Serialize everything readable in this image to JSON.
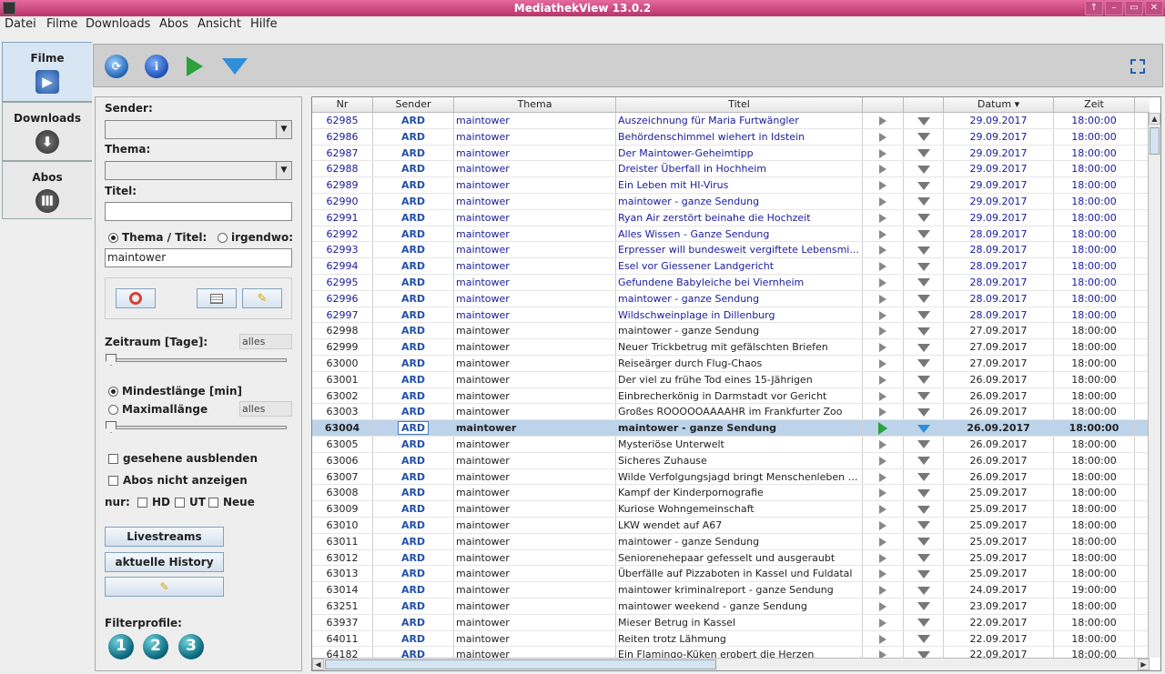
{
  "window": {
    "title": "MediathekView 13.0.2",
    "controls": [
      "↑",
      "–",
      "▭",
      "✕"
    ]
  },
  "menu": [
    {
      "label": "Datei"
    },
    {
      "label": "Filme"
    },
    {
      "label": "Downloads"
    },
    {
      "label": "Abos"
    },
    {
      "label": "Ansicht"
    },
    {
      "label": "Hilfe"
    }
  ],
  "sidetabs": [
    {
      "label": "Filme",
      "icon": "play-film-icon",
      "active": true
    },
    {
      "label": "Downloads",
      "icon": "download-arrow-icon",
      "active": false
    },
    {
      "label": "Abos",
      "icon": "abos-icon",
      "active": false
    }
  ],
  "toolbar": {
    "icons": [
      "update-filmlist-icon",
      "info-icon",
      "play-icon",
      "download-icon"
    ],
    "fullscreen_icon": "fullscreen-icon"
  },
  "filter": {
    "sender_label": "Sender:",
    "sender_value": "",
    "thema_label": "Thema:",
    "thema_value": "",
    "titel_label": "Titel:",
    "titel_value": "",
    "radio_thema_titel": "Thema / Titel:",
    "radio_irgendwo": "irgendwo:",
    "search_value": "maintower",
    "zeitraum_label": "Zeitraum [Tage]:",
    "zeitraum_value": "alles",
    "zeitraum_level": 0,
    "mindestlaenge_label": "Mindestlänge [min]",
    "maximallaenge_label": "Maximallänge",
    "maximallaenge_value": "alles",
    "laenge_level": 0,
    "gesehene_ausblenden": "gesehene ausblenden",
    "abos_nicht_anzeigen": "Abos nicht anzeigen",
    "nur_label": "nur:",
    "hd": "HD",
    "ut": "UT",
    "neue": "Neue",
    "livestreams": "Livestreams",
    "aktuelle_history": "aktuelle History",
    "filterprofile_label": "Filterprofile:",
    "profiles": [
      "1",
      "2",
      "3"
    ]
  },
  "table": {
    "columns": [
      "Nr",
      "Sender",
      "Thema",
      "Titel",
      "",
      "",
      "Datum ▾",
      "Zeit"
    ],
    "rows": [
      {
        "nr": "62985",
        "sender": "ARD",
        "thema": "maintower",
        "titel": "Auszeichnung für Maria Furtwängler",
        "datum": "29.09.2017",
        "zeit": "18:00:00",
        "new": true
      },
      {
        "nr": "62986",
        "sender": "ARD",
        "thema": "maintower",
        "titel": "Behördenschimmel wiehert in Idstein",
        "datum": "29.09.2017",
        "zeit": "18:00:00",
        "new": true
      },
      {
        "nr": "62987",
        "sender": "ARD",
        "thema": "maintower",
        "titel": "Der Maintower-Geheimtipp",
        "datum": "29.09.2017",
        "zeit": "18:00:00",
        "new": true
      },
      {
        "nr": "62988",
        "sender": "ARD",
        "thema": "maintower",
        "titel": "Dreister Überfall in Hochheim",
        "datum": "29.09.2017",
        "zeit": "18:00:00",
        "new": true
      },
      {
        "nr": "62989",
        "sender": "ARD",
        "thema": "maintower",
        "titel": "Ein Leben mit HI-Virus",
        "datum": "29.09.2017",
        "zeit": "18:00:00",
        "new": true
      },
      {
        "nr": "62990",
        "sender": "ARD",
        "thema": "maintower",
        "titel": "maintower - ganze Sendung",
        "datum": "29.09.2017",
        "zeit": "18:00:00",
        "new": true
      },
      {
        "nr": "62991",
        "sender": "ARD",
        "thema": "maintower",
        "titel": "Ryan Air zerstört beinahe die Hochzeit",
        "datum": "29.09.2017",
        "zeit": "18:00:00",
        "new": true
      },
      {
        "nr": "62992",
        "sender": "ARD",
        "thema": "maintower",
        "titel": "Alles Wissen - Ganze Sendung",
        "datum": "28.09.2017",
        "zeit": "18:00:00",
        "new": true
      },
      {
        "nr": "62993",
        "sender": "ARD",
        "thema": "maintower",
        "titel": "Erpresser will bundesweit vergiftete Lebensmi...",
        "datum": "28.09.2017",
        "zeit": "18:00:00",
        "new": true
      },
      {
        "nr": "62994",
        "sender": "ARD",
        "thema": "maintower",
        "titel": "Esel vor Giessener Landgericht",
        "datum": "28.09.2017",
        "zeit": "18:00:00",
        "new": true
      },
      {
        "nr": "62995",
        "sender": "ARD",
        "thema": "maintower",
        "titel": "Gefundene Babyleiche bei Viernheim",
        "datum": "28.09.2017",
        "zeit": "18:00:00",
        "new": true
      },
      {
        "nr": "62996",
        "sender": "ARD",
        "thema": "maintower",
        "titel": "maintower - ganze Sendung",
        "datum": "28.09.2017",
        "zeit": "18:00:00",
        "new": true
      },
      {
        "nr": "62997",
        "sender": "ARD",
        "thema": "maintower",
        "titel": "Wildschweinplage in Dillenburg",
        "datum": "28.09.2017",
        "zeit": "18:00:00",
        "new": true
      },
      {
        "nr": "62998",
        "sender": "ARD",
        "thema": "maintower",
        "titel": "maintower - ganze Sendung",
        "datum": "27.09.2017",
        "zeit": "18:00:00",
        "new": false
      },
      {
        "nr": "62999",
        "sender": "ARD",
        "thema": "maintower",
        "titel": "Neuer Trickbetrug mit gefälschten Briefen",
        "datum": "27.09.2017",
        "zeit": "18:00:00",
        "new": false
      },
      {
        "nr": "63000",
        "sender": "ARD",
        "thema": "maintower",
        "titel": "Reiseärger durch Flug-Chaos",
        "datum": "27.09.2017",
        "zeit": "18:00:00",
        "new": false
      },
      {
        "nr": "63001",
        "sender": "ARD",
        "thema": "maintower",
        "titel": "Der viel zu frühe Tod eines 15-Jährigen",
        "datum": "26.09.2017",
        "zeit": "18:00:00",
        "new": false
      },
      {
        "nr": "63002",
        "sender": "ARD",
        "thema": "maintower",
        "titel": "Einbrecherkönig in Darmstadt vor Gericht",
        "datum": "26.09.2017",
        "zeit": "18:00:00",
        "new": false
      },
      {
        "nr": "63003",
        "sender": "ARD",
        "thema": "maintower",
        "titel": "Großes ROOOOOAAAAHR im Frankfurter Zoo",
        "datum": "26.09.2017",
        "zeit": "18:00:00",
        "new": false
      },
      {
        "nr": "63004",
        "sender": "ARD",
        "thema": "maintower",
        "titel": "maintower - ganze Sendung",
        "datum": "26.09.2017",
        "zeit": "18:00:00",
        "new": false,
        "selected": true
      },
      {
        "nr": "63005",
        "sender": "ARD",
        "thema": "maintower",
        "titel": "Mysteriöse Unterwelt",
        "datum": "26.09.2017",
        "zeit": "18:00:00",
        "new": false
      },
      {
        "nr": "63006",
        "sender": "ARD",
        "thema": "maintower",
        "titel": "Sicheres Zuhause",
        "datum": "26.09.2017",
        "zeit": "18:00:00",
        "new": false
      },
      {
        "nr": "63007",
        "sender": "ARD",
        "thema": "maintower",
        "titel": "Wilde Verfolgungsjagd bringt Menschenleben i...",
        "datum": "26.09.2017",
        "zeit": "18:00:00",
        "new": false
      },
      {
        "nr": "63008",
        "sender": "ARD",
        "thema": "maintower",
        "titel": "Kampf der Kinderpornografie",
        "datum": "25.09.2017",
        "zeit": "18:00:00",
        "new": false
      },
      {
        "nr": "63009",
        "sender": "ARD",
        "thema": "maintower",
        "titel": "Kuriose Wohngemeinschaft",
        "datum": "25.09.2017",
        "zeit": "18:00:00",
        "new": false
      },
      {
        "nr": "63010",
        "sender": "ARD",
        "thema": "maintower",
        "titel": "LKW wendet auf A67",
        "datum": "25.09.2017",
        "zeit": "18:00:00",
        "new": false
      },
      {
        "nr": "63011",
        "sender": "ARD",
        "thema": "maintower",
        "titel": "maintower - ganze Sendung",
        "datum": "25.09.2017",
        "zeit": "18:00:00",
        "new": false
      },
      {
        "nr": "63012",
        "sender": "ARD",
        "thema": "maintower",
        "titel": "Seniorenehepaar gefesselt und ausgeraubt",
        "datum": "25.09.2017",
        "zeit": "18:00:00",
        "new": false
      },
      {
        "nr": "63013",
        "sender": "ARD",
        "thema": "maintower",
        "titel": "Überfälle auf Pizzaboten in Kassel und Fuldatal",
        "datum": "25.09.2017",
        "zeit": "18:00:00",
        "new": false
      },
      {
        "nr": "63014",
        "sender": "ARD",
        "thema": "maintower",
        "titel": "maintower kriminalreport - ganze Sendung",
        "datum": "24.09.2017",
        "zeit": "19:00:00",
        "new": false
      },
      {
        "nr": "63251",
        "sender": "ARD",
        "thema": "maintower",
        "titel": "maintower weekend - ganze Sendung",
        "datum": "23.09.2017",
        "zeit": "18:00:00",
        "new": false
      },
      {
        "nr": "63937",
        "sender": "ARD",
        "thema": "maintower",
        "titel": "Mieser Betrug in Kassel",
        "datum": "22.09.2017",
        "zeit": "18:00:00",
        "new": false
      },
      {
        "nr": "64011",
        "sender": "ARD",
        "thema": "maintower",
        "titel": "Reiten trotz Lähmung",
        "datum": "22.09.2017",
        "zeit": "18:00:00",
        "new": false
      },
      {
        "nr": "64182",
        "sender": "ARD",
        "thema": "maintower",
        "titel": "Ein Flamingo-Küken erobert die Herzen",
        "datum": "22.09.2017",
        "zeit": "18:00:00",
        "new": false
      }
    ]
  }
}
